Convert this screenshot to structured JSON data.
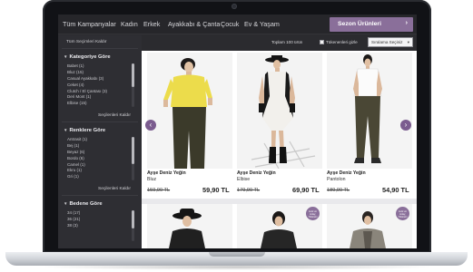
{
  "nav": {
    "items": [
      "Tüm Kampanyalar",
      "Kadın",
      "Erkek",
      "Ayakkabı & Çanta",
      "Çocuk",
      "Ev & Yaşam"
    ],
    "season_button": "Sezon Ürünleri",
    "season_chevron": "›"
  },
  "sidebar": {
    "clear_all": "Tüm Seçimleri Kaldır",
    "category": {
      "title": "Kategoriye Göre",
      "items": [
        "Babet (1)",
        "Bluz (15)",
        "Casual Ayakkabı (3)",
        "Ceket (4)",
        "Clutch / El Çantası (3)",
        "Deri Mont (1)",
        "Elbise (15)"
      ],
      "clear": "Seçilenleri Kaldır"
    },
    "colors": {
      "title": "Renklere Göre",
      "items": [
        "Antrasit (1)",
        "Bej (1)",
        "Beyaz (6)",
        "Bordo (6)",
        "Camel (1)",
        "Ekru (1)",
        "Gri (1)"
      ],
      "clear": "Seçilenleri Kaldır"
    },
    "size": {
      "title": "Bedene Göre",
      "items": [
        "34 (17)",
        "36 (21)",
        "38 (3)"
      ]
    },
    "toggle_glyph": "▼"
  },
  "toolbar": {
    "total": "Toplam 100 ürün",
    "stock_filter": "Tükenenleri gizle",
    "sort": "Sıralama Seçiniz",
    "sort_chevron": "▾"
  },
  "products": [
    {
      "brand": "Ayşe Deniz Yeğin",
      "type": "Bluz",
      "old_price": "159,90 TL",
      "new_price": "59,90 TL"
    },
    {
      "brand": "Ayşe Deniz Yeğin",
      "type": "Elbise",
      "old_price": "179,90 TL",
      "new_price": "69,90 TL"
    },
    {
      "brand": "Ayşe Deniz Yeğin",
      "type": "Pantolon",
      "old_price": "189,90 TL",
      "new_price": "54,90 TL"
    }
  ],
  "badges": [
    "Hızlı ve kolay, Tükenen",
    "Hızlı ve kolay, Tükenen"
  ],
  "arrows": {
    "prev": "‹",
    "next": "›"
  },
  "colors": {
    "accent": "#8a6f9a",
    "arrow": "#7b5c8f",
    "nav_bg": "#26262a",
    "sidebar_bg": "#2e2e33"
  }
}
